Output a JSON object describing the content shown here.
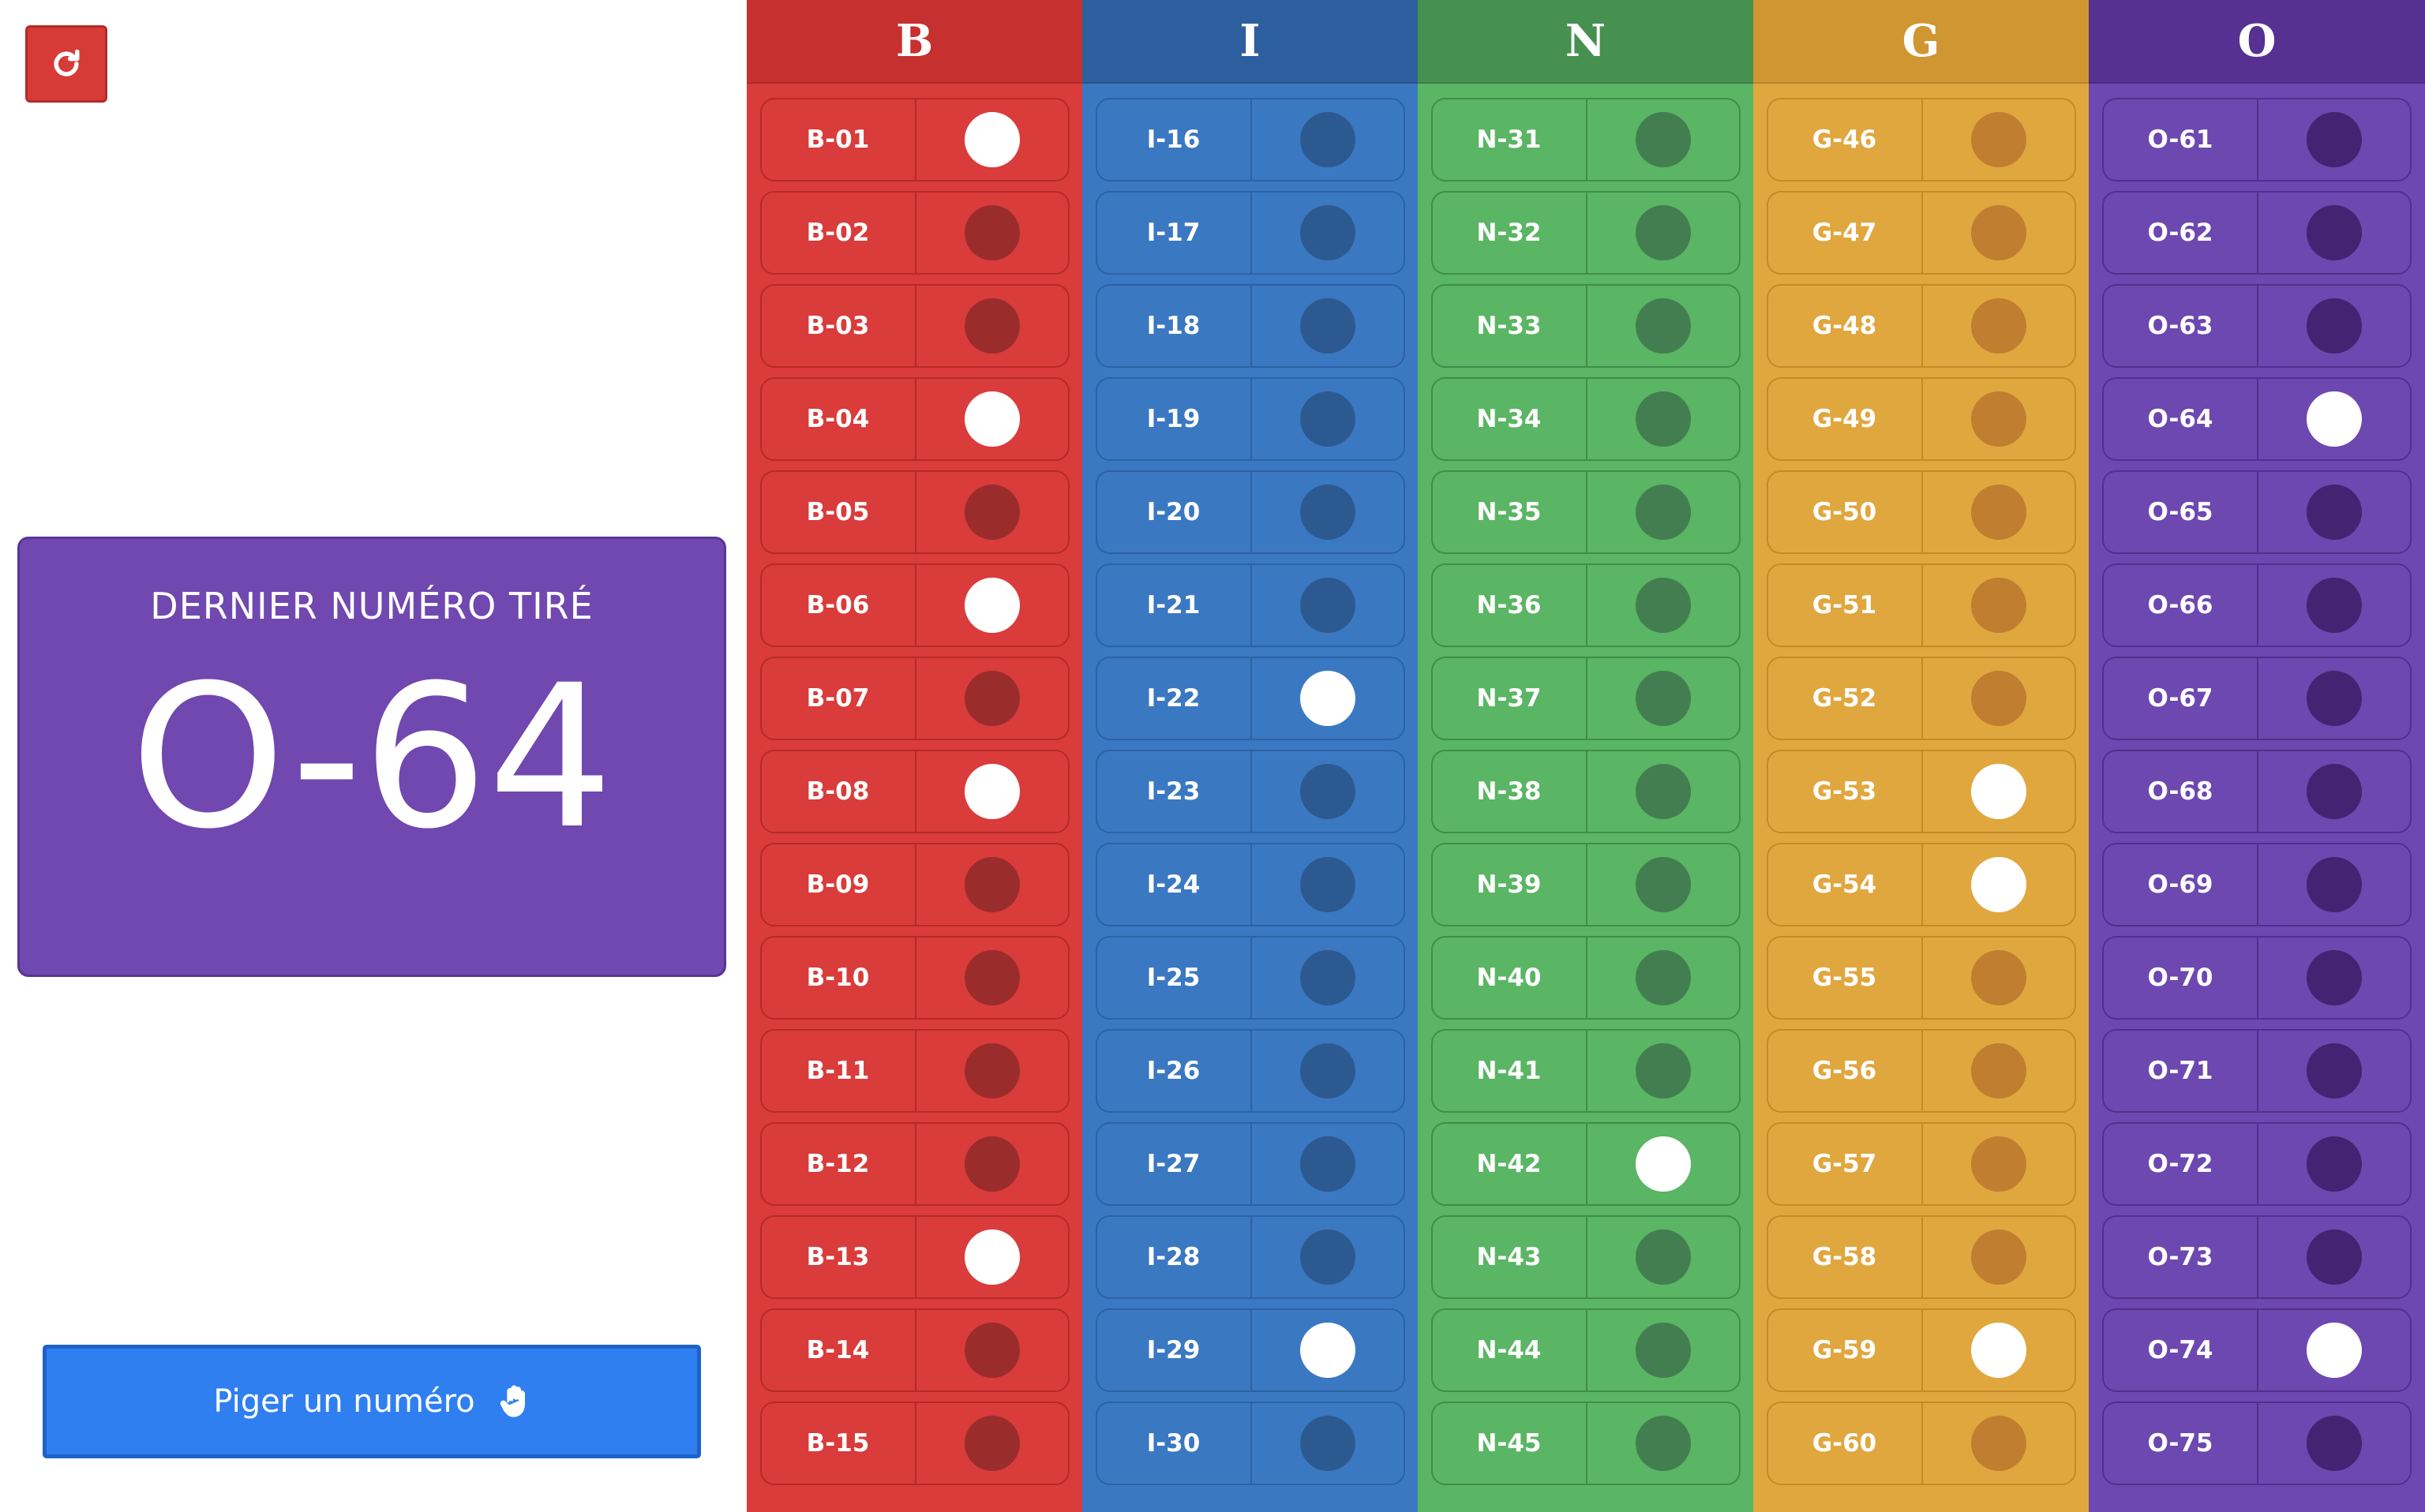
{
  "reset_button": {
    "icon": "refresh-icon"
  },
  "last_drawn": {
    "title": "DERNIER NUMÉRO TIRÉ",
    "value": "O-64"
  },
  "draw_button": {
    "label": "Piger un numéro",
    "icon": "hand-icon"
  },
  "columns": [
    {
      "letter": "B",
      "header_color": "#c6302f",
      "bg_color": "#d93c3b",
      "cell_border": "#b52a29",
      "dot_off": "#9b2c2c",
      "cells": [
        {
          "label": "B-01",
          "drawn": true
        },
        {
          "label": "B-02",
          "drawn": false
        },
        {
          "label": "B-03",
          "drawn": false
        },
        {
          "label": "B-04",
          "drawn": true
        },
        {
          "label": "B-05",
          "drawn": false
        },
        {
          "label": "B-06",
          "drawn": true
        },
        {
          "label": "B-07",
          "drawn": false
        },
        {
          "label": "B-08",
          "drawn": true
        },
        {
          "label": "B-09",
          "drawn": false
        },
        {
          "label": "B-10",
          "drawn": false
        },
        {
          "label": "B-11",
          "drawn": false
        },
        {
          "label": "B-12",
          "drawn": false
        },
        {
          "label": "B-13",
          "drawn": true
        },
        {
          "label": "B-14",
          "drawn": false
        },
        {
          "label": "B-15",
          "drawn": false
        }
      ]
    },
    {
      "letter": "I",
      "header_color": "#2d5f9e",
      "bg_color": "#3b78c2",
      "cell_border": "#2c62a3",
      "dot_off": "#2c5a90",
      "cells": [
        {
          "label": "I-16",
          "drawn": false
        },
        {
          "label": "I-17",
          "drawn": false
        },
        {
          "label": "I-18",
          "drawn": false
        },
        {
          "label": "I-19",
          "drawn": false
        },
        {
          "label": "I-20",
          "drawn": false
        },
        {
          "label": "I-21",
          "drawn": false
        },
        {
          "label": "I-22",
          "drawn": true
        },
        {
          "label": "I-23",
          "drawn": false
        },
        {
          "label": "I-24",
          "drawn": false
        },
        {
          "label": "I-25",
          "drawn": false
        },
        {
          "label": "I-26",
          "drawn": false
        },
        {
          "label": "I-27",
          "drawn": false
        },
        {
          "label": "I-28",
          "drawn": false
        },
        {
          "label": "I-29",
          "drawn": true
        },
        {
          "label": "I-30",
          "drawn": false
        }
      ]
    },
    {
      "letter": "N",
      "header_color": "#469050",
      "bg_color": "#5ab564",
      "cell_border": "#3e8f48",
      "dot_off": "#437e50",
      "cells": [
        {
          "label": "N-31",
          "drawn": false
        },
        {
          "label": "N-32",
          "drawn": false
        },
        {
          "label": "N-33",
          "drawn": false
        },
        {
          "label": "N-34",
          "drawn": false
        },
        {
          "label": "N-35",
          "drawn": false
        },
        {
          "label": "N-36",
          "drawn": false
        },
        {
          "label": "N-37",
          "drawn": false
        },
        {
          "label": "N-38",
          "drawn": false
        },
        {
          "label": "N-39",
          "drawn": false
        },
        {
          "label": "N-40",
          "drawn": false
        },
        {
          "label": "N-41",
          "drawn": false
        },
        {
          "label": "N-42",
          "drawn": true
        },
        {
          "label": "N-43",
          "drawn": false
        },
        {
          "label": "N-44",
          "drawn": false
        },
        {
          "label": "N-45",
          "drawn": false
        }
      ]
    },
    {
      "letter": "G",
      "header_color": "#cf9632",
      "bg_color": "#e0a73f",
      "cell_border": "#c58a28",
      "dot_off": "#bf7e30",
      "cells": [
        {
          "label": "G-46",
          "drawn": false
        },
        {
          "label": "G-47",
          "drawn": false
        },
        {
          "label": "G-48",
          "drawn": false
        },
        {
          "label": "G-49",
          "drawn": false
        },
        {
          "label": "G-50",
          "drawn": false
        },
        {
          "label": "G-51",
          "drawn": false
        },
        {
          "label": "G-52",
          "drawn": false
        },
        {
          "label": "G-53",
          "drawn": true
        },
        {
          "label": "G-54",
          "drawn": true
        },
        {
          "label": "G-55",
          "drawn": false
        },
        {
          "label": "G-56",
          "drawn": false
        },
        {
          "label": "G-57",
          "drawn": false
        },
        {
          "label": "G-58",
          "drawn": false
        },
        {
          "label": "G-59",
          "drawn": true
        },
        {
          "label": "G-60",
          "drawn": false
        }
      ]
    },
    {
      "letter": "O",
      "header_color": "#563191",
      "bg_color": "#6d48b0",
      "cell_border": "#532f8e",
      "dot_off": "#432472",
      "cells": [
        {
          "label": "O-61",
          "drawn": false
        },
        {
          "label": "O-62",
          "drawn": false
        },
        {
          "label": "O-63",
          "drawn": false
        },
        {
          "label": "O-64",
          "drawn": true
        },
        {
          "label": "O-65",
          "drawn": false
        },
        {
          "label": "O-66",
          "drawn": false
        },
        {
          "label": "O-67",
          "drawn": false
        },
        {
          "label": "O-68",
          "drawn": false
        },
        {
          "label": "O-69",
          "drawn": false
        },
        {
          "label": "O-70",
          "drawn": false
        },
        {
          "label": "O-71",
          "drawn": false
        },
        {
          "label": "O-72",
          "drawn": false
        },
        {
          "label": "O-73",
          "drawn": false
        },
        {
          "label": "O-74",
          "drawn": true
        },
        {
          "label": "O-75",
          "drawn": false
        }
      ]
    }
  ]
}
